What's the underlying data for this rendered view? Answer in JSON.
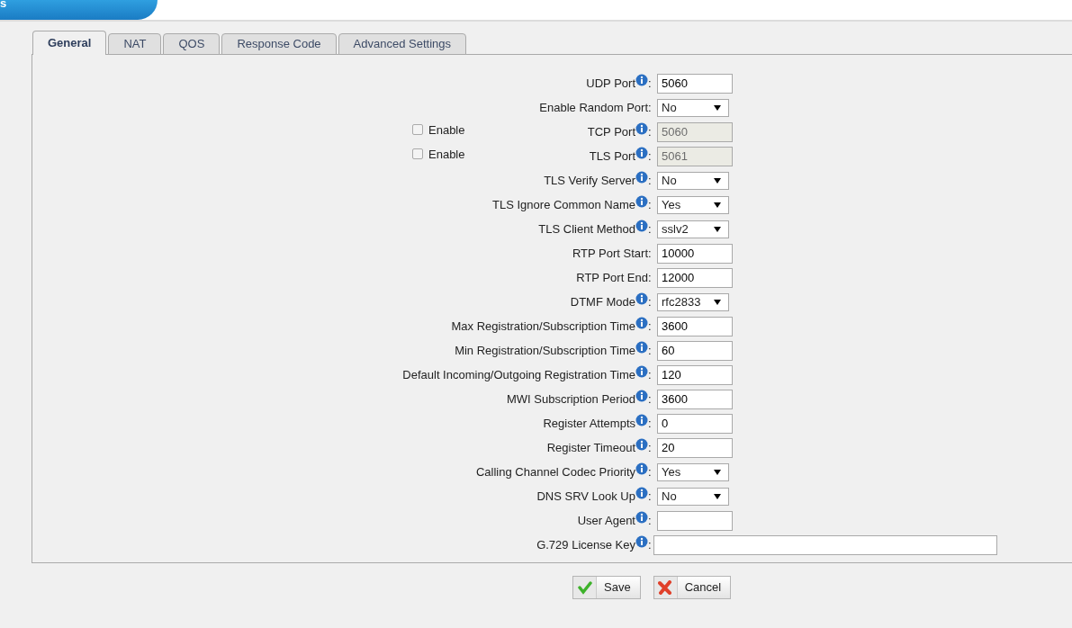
{
  "header": {
    "title": "s"
  },
  "tabs": [
    {
      "label": "General",
      "selected": true
    },
    {
      "label": "NAT",
      "selected": false
    },
    {
      "label": "QOS",
      "selected": false
    },
    {
      "label": "Response Code",
      "selected": false
    },
    {
      "label": "Advanced Settings",
      "selected": false
    }
  ],
  "fields": [
    {
      "label": "UDP Port",
      "info": true,
      "colon": ":",
      "kind": "text",
      "value": "5060",
      "disabled": false
    },
    {
      "label": "Enable Random Port",
      "info": false,
      "colon": ":",
      "kind": "select",
      "value": "No"
    },
    {
      "label": "TCP Port",
      "info": true,
      "colon": ":",
      "kind": "text",
      "value": "5060",
      "disabled": true,
      "enable": {
        "label": "Enable",
        "checked": false
      }
    },
    {
      "label": "TLS Port",
      "info": true,
      "colon": ":",
      "kind": "text",
      "value": "5061",
      "disabled": true,
      "enable": {
        "label": "Enable",
        "checked": false
      }
    },
    {
      "label": "TLS Verify Server",
      "info": true,
      "colon": ":",
      "kind": "select",
      "value": "No"
    },
    {
      "label": "TLS Ignore Common Name",
      "info": true,
      "colon": ":",
      "kind": "select",
      "value": "Yes"
    },
    {
      "label": "TLS Client Method",
      "info": true,
      "colon": ":",
      "kind": "select",
      "value": "sslv2"
    },
    {
      "label": "RTP Port Start",
      "info": false,
      "colon": ":",
      "kind": "text",
      "value": "10000",
      "disabled": false
    },
    {
      "label": "RTP Port End",
      "info": false,
      "colon": ":",
      "kind": "text",
      "value": "12000",
      "disabled": false
    },
    {
      "label": "DTMF Mode",
      "info": true,
      "colon": ":",
      "kind": "select",
      "value": "rfc2833"
    },
    {
      "label": "Max Registration/Subscription Time",
      "info": true,
      "colon": ":",
      "kind": "text",
      "value": "3600",
      "disabled": false
    },
    {
      "label": "Min Registration/Subscription Time",
      "info": true,
      "colon": ":",
      "kind": "text",
      "value": "60",
      "disabled": false
    },
    {
      "label": "Default Incoming/Outgoing Registration Time",
      "info": true,
      "colon": ":",
      "kind": "text",
      "value": "120",
      "disabled": false
    },
    {
      "label": "MWI Subscription Period",
      "info": true,
      "colon": ":",
      "kind": "text",
      "value": "3600",
      "disabled": false
    },
    {
      "label": "Register Attempts",
      "info": true,
      "colon": ":",
      "kind": "text",
      "value": "0",
      "disabled": false
    },
    {
      "label": "Register Timeout",
      "info": true,
      "colon": ":",
      "kind": "text",
      "value": "20",
      "disabled": false
    },
    {
      "label": "Calling Channel Codec Priority",
      "info": true,
      "colon": ":",
      "kind": "select",
      "value": "Yes"
    },
    {
      "label": "DNS SRV Look Up",
      "info": true,
      "colon": ":",
      "kind": "select",
      "value": "No"
    },
    {
      "label": "User Agent",
      "info": true,
      "colon": ":",
      "kind": "text",
      "disabled": false
    },
    {
      "label": "G.729 License Key",
      "info": true,
      "colon": ":",
      "kind": "wide",
      "disabled": false
    }
  ],
  "buttons": [
    {
      "label": "Save",
      "kind": "save"
    },
    {
      "label": "Cancel",
      "kind": "cancel"
    }
  ]
}
